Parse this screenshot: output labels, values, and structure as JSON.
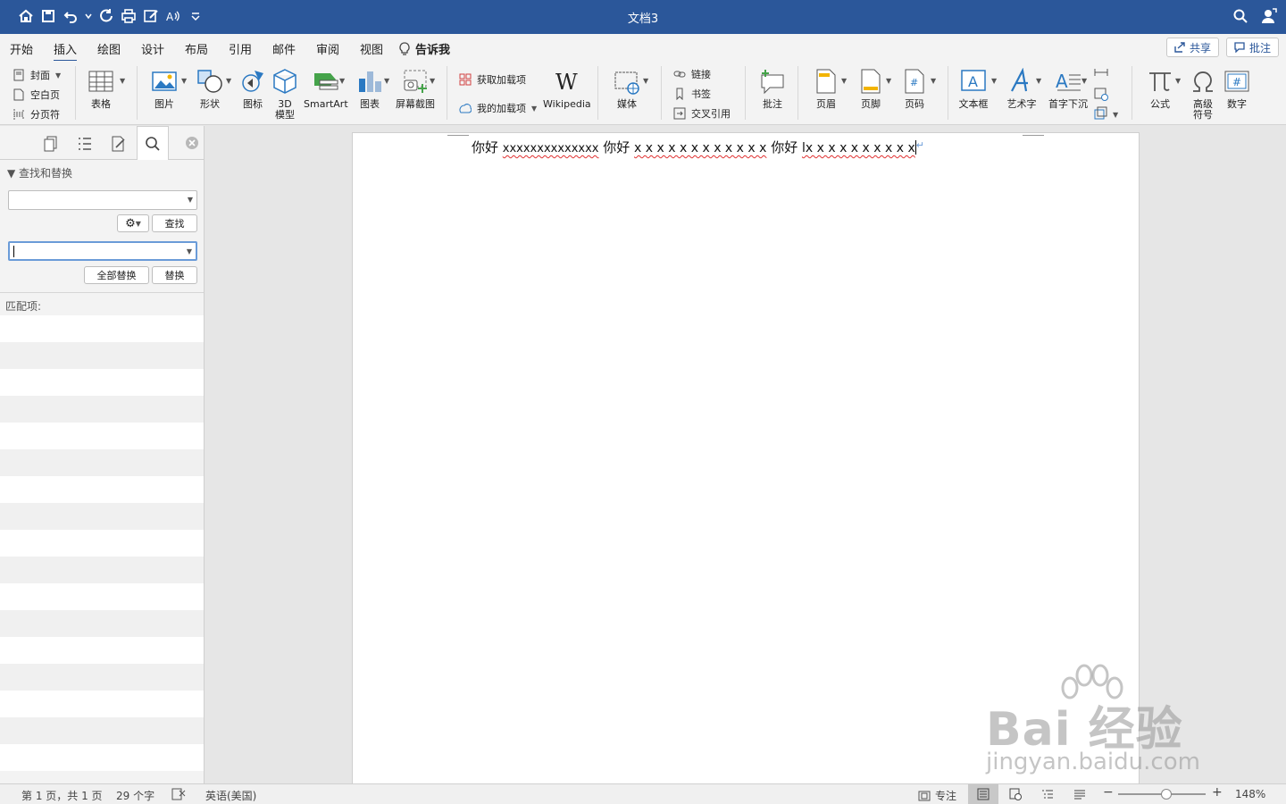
{
  "window": {
    "title": "文档3"
  },
  "tabs": [
    "开始",
    "插入",
    "绘图",
    "设计",
    "布局",
    "引用",
    "邮件",
    "审阅",
    "视图"
  ],
  "active_tab": "插入",
  "tell_me": "告诉我",
  "share_label": "共享",
  "comment_label": "批注",
  "ribbon": {
    "cover": "封面",
    "blank_page": "空白页",
    "page_break": "分页符",
    "table": "表格",
    "picture": "图片",
    "shape": "形状",
    "icons": "图标",
    "model3d_a": "3D",
    "model3d_b": "模型",
    "smartart": "SmartArt",
    "chart": "图表",
    "screenshot": "屏幕截图",
    "get_addins": "获取加载项",
    "my_addins": "我的加载项",
    "wikipedia": "Wikipedia",
    "media": "媒体",
    "link": "链接",
    "bookmark": "书签",
    "cross_ref": "交叉引用",
    "comment": "批注",
    "header": "页眉",
    "footer": "页脚",
    "page_number": "页码",
    "textbox": "文本框",
    "wordart": "艺术字",
    "dropcap": "首字下沉",
    "equation": "公式",
    "symbol_a": "高级",
    "symbol_b": "符号",
    "number": "数字"
  },
  "pane": {
    "section": "查找和替换",
    "find_button": "查找",
    "replace_all_button": "全部替换",
    "replace_button": "替换",
    "matches_label": "匹配项:",
    "find_value": "",
    "replace_value": ""
  },
  "document": {
    "seg1": "你好 ",
    "seg2": "xxxxxxxxxxxxxx",
    "seg3": " 你好 ",
    "seg4": "x x x x x x x x x x x x",
    "seg5": " 你好 ",
    "seg6": "lx x x x x x x x x x",
    "pilcrow": "↵"
  },
  "status": {
    "page": "第 1 页，共 1 页",
    "words": "29 个字",
    "language": "英语(美国)",
    "focus": "专注",
    "zoom": "148%"
  },
  "watermark": {
    "brand": "Bai 经验",
    "url": "jingyan.baidu.com"
  }
}
